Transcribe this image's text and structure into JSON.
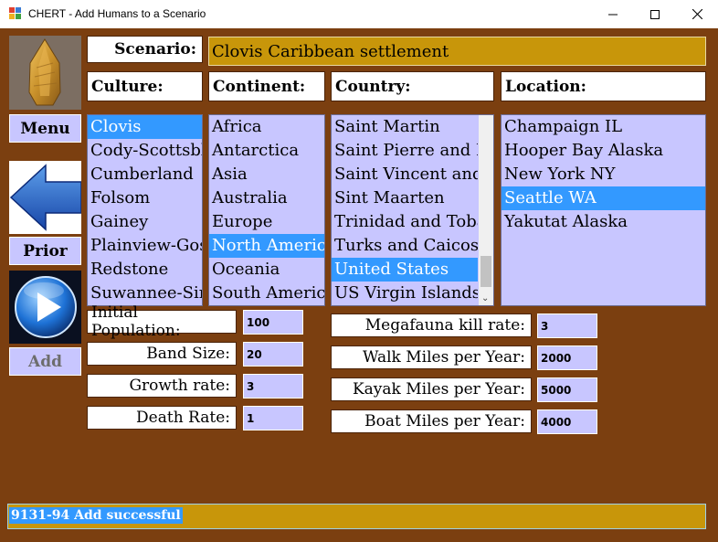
{
  "window": {
    "title": "CHERT - Add Humans to a Scenario",
    "icon": "app-window-icon",
    "controls": [
      "minimize-icon",
      "maximize-icon",
      "close-icon"
    ]
  },
  "scenario": {
    "label": "Scenario:",
    "value": "Clovis Caribbean settlement"
  },
  "headers": {
    "culture": "Culture:",
    "continent": "Continent:",
    "country": "Country:",
    "location": "Location:"
  },
  "lists": {
    "culture": {
      "items": [
        "Clovis",
        "Cody-Scottsbluff",
        "Cumberland",
        "Folsom",
        "Gainey",
        "Plainview-Goshen",
        "Redstone",
        "Suwannee-Simpson"
      ],
      "selected": "Clovis"
    },
    "continent": {
      "items": [
        "Africa",
        "Antarctica",
        "Asia",
        "Australia",
        "Europe",
        "North America",
        "Oceania",
        "South America"
      ],
      "selected": "North America"
    },
    "country": {
      "items": [
        "Saint Martin",
        "Saint Pierre and Miquelon",
        "Saint Vincent and the Grenadines",
        "Sint Maarten",
        "Trinidad and Tobago",
        "Turks and Caicos Islands",
        "United States",
        "US Virgin Islands"
      ],
      "selected": "United States"
    },
    "location": {
      "items": [
        "Champaign IL",
        "Hooper Bay Alaska",
        "New York NY",
        "Seattle WA",
        "Yakutat Alaska"
      ],
      "selected": "Seattle WA"
    }
  },
  "params_left": [
    {
      "label": "Initial Population:",
      "value": "100"
    },
    {
      "label": "Band Size:",
      "value": "20"
    },
    {
      "label": "Growth rate:",
      "value": "3"
    },
    {
      "label": "Death Rate:",
      "value": "1"
    }
  ],
  "params_right": [
    {
      "label": "Megafauna kill rate:",
      "value": "3"
    },
    {
      "label": "Walk Miles per Year:",
      "value": "2000"
    },
    {
      "label": "Kayak Miles per Year:",
      "value": "5000"
    },
    {
      "label": "Boat Miles per Year:",
      "value": "4000"
    }
  ],
  "side": {
    "logo": "clovis-point-image",
    "menu_label": "Menu",
    "back_icon": "back-arrow-icon",
    "prior_label": "Prior",
    "play_icon": "play-icon",
    "add_label": "Add"
  },
  "status": {
    "text": "9131-94 Add successful"
  },
  "colors": {
    "background": "#7b3f10",
    "gold": "#c8960a",
    "list_bg": "#c8c6ff",
    "selection": "#3399ff"
  }
}
